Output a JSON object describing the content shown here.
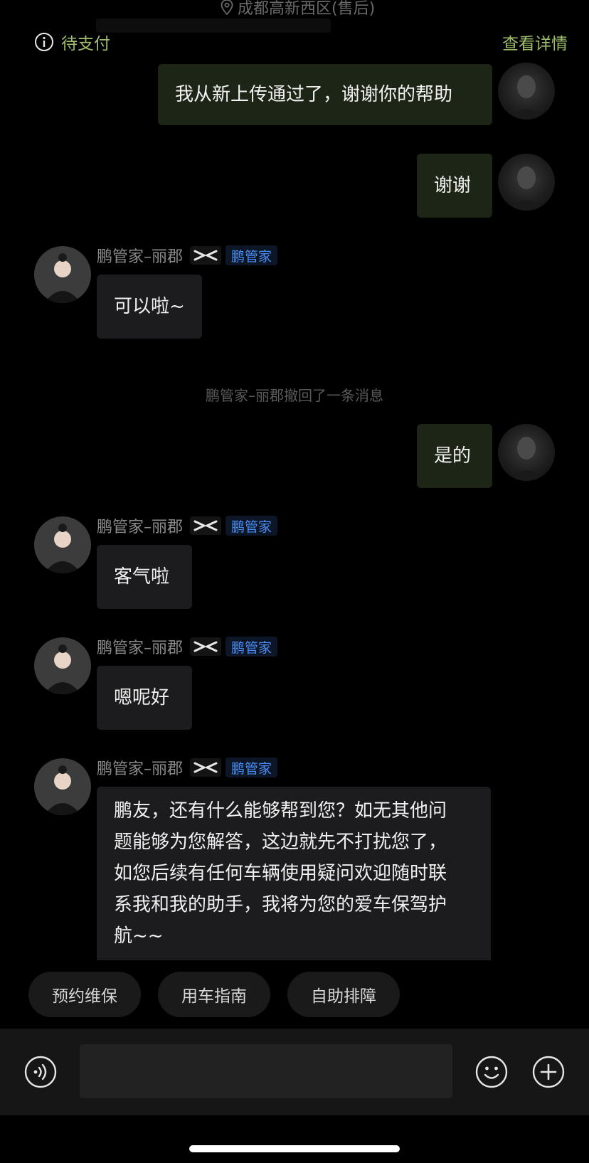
{
  "header": {
    "location": "成都高新西区(售后)",
    "status_label": "待支付",
    "details_link": "查看详情"
  },
  "messages": [
    {
      "side": "user",
      "text": "我从新上传通过了，谢谢你的帮助"
    },
    {
      "side": "user",
      "text": "谢谢"
    },
    {
      "side": "agent",
      "sender": "鹏管家–丽郡",
      "role": "鹏管家",
      "text": "可以啦~"
    },
    {
      "side": "system",
      "text": "鹏管家–丽郡撤回了一条消息"
    },
    {
      "side": "user",
      "text": "是的"
    },
    {
      "side": "agent",
      "sender": "鹏管家–丽郡",
      "role": "鹏管家",
      "text": "客气啦"
    },
    {
      "side": "agent",
      "sender": "鹏管家–丽郡",
      "role": "鹏管家",
      "text": "嗯呢好"
    },
    {
      "side": "agent",
      "sender": "鹏管家–丽郡",
      "role": "鹏管家",
      "lines": [
        "鹏友，还有什么能够帮到您？如无其他问",
        "题能够为您解答，这边就先不打扰您了，",
        "如您后续有任何车辆使用疑问欢迎随时联",
        "系我和我的助手，我将为您的爱车保驾护",
        "航~~"
      ]
    }
  ],
  "quick_actions": [
    "预约维保",
    "用车指南",
    "自助排障"
  ],
  "input": {
    "value": ""
  },
  "colors": {
    "accent_green": "#9fbf6c",
    "user_bubble": "#1d2616",
    "agent_bubble": "#1c1c1e",
    "role_blue": "#4a8df5"
  },
  "icons": [
    "location-pin-icon",
    "info-icon",
    "brand-logo-icon",
    "voice-icon",
    "emoji-icon",
    "plus-icon"
  ]
}
